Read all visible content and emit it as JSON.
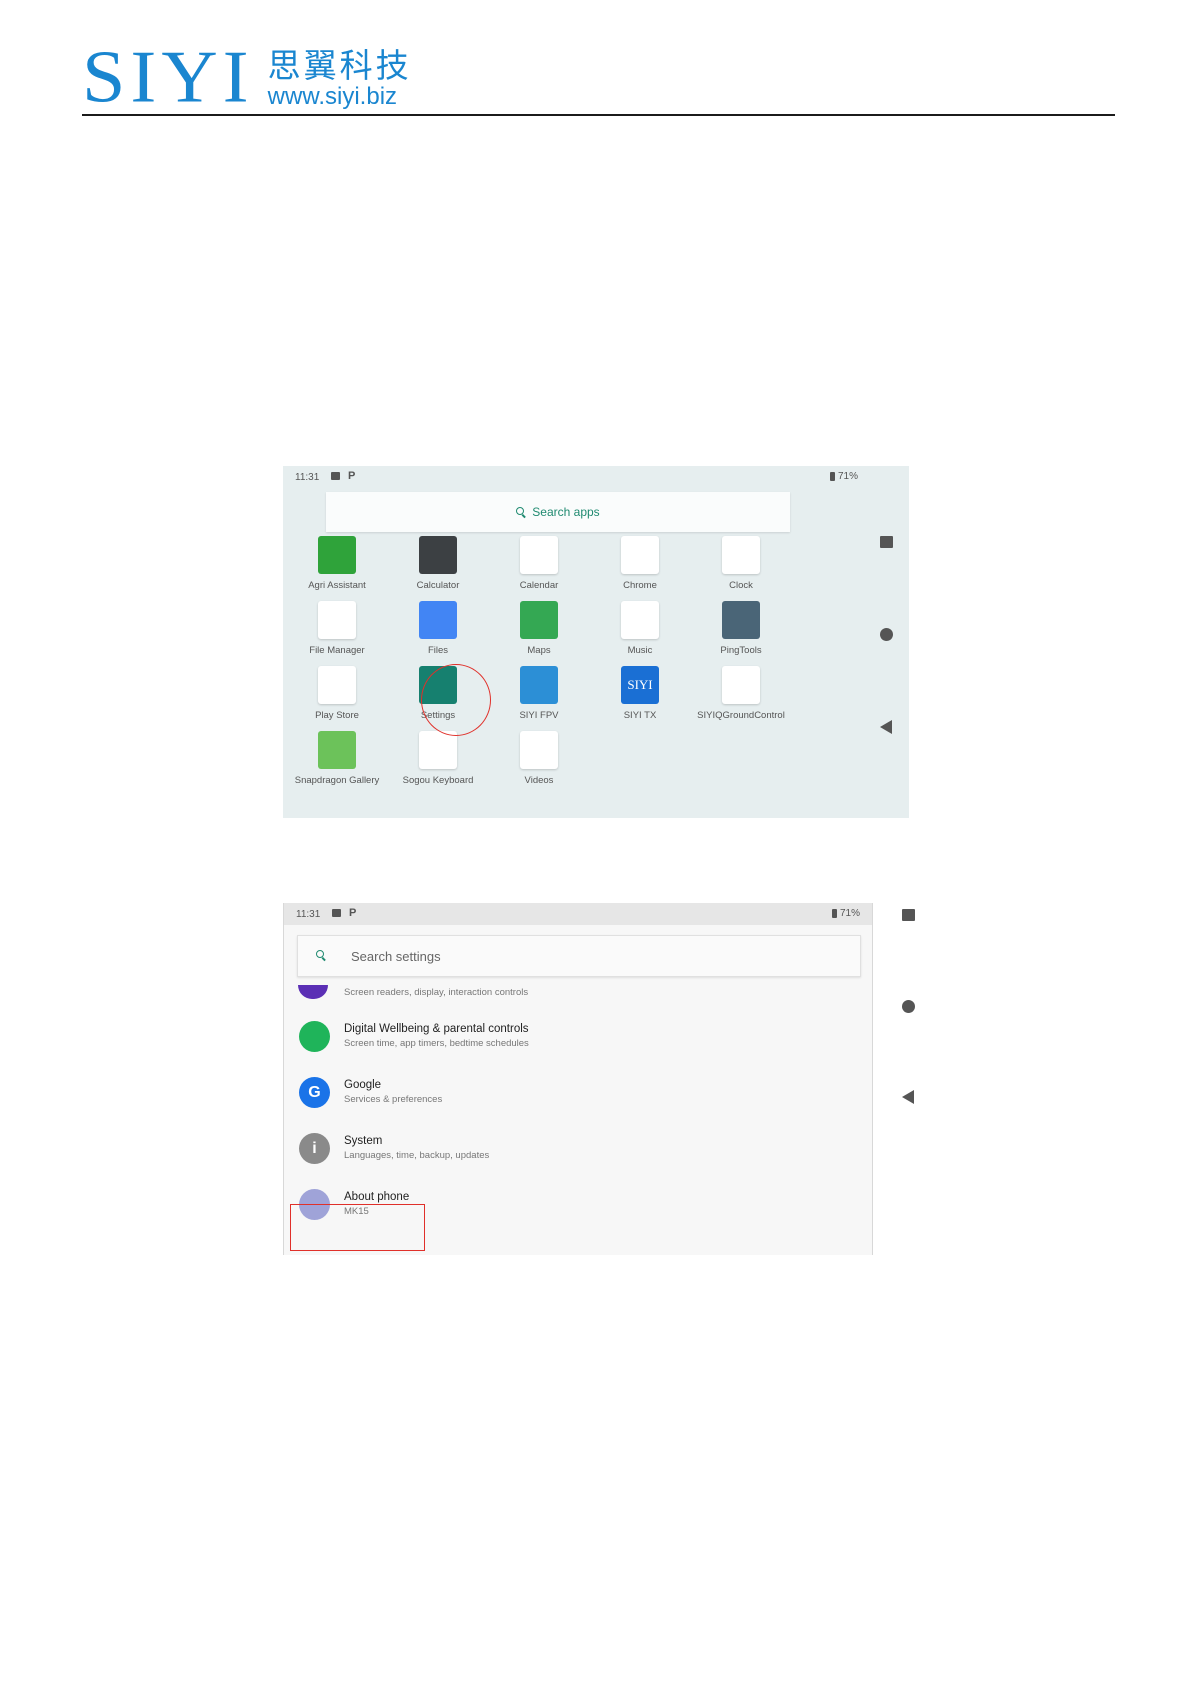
{
  "header": {
    "logo_latin": "SIYI",
    "logo_chinese": "思翼科技",
    "logo_url": "www.siyi.biz"
  },
  "launcher": {
    "status": {
      "time": "11:31",
      "notif": "P",
      "battery": "71%"
    },
    "search_label": "Search apps",
    "apps": [
      {
        "label": "Agri Assistant",
        "icon": "agri-assistant-icon",
        "color": "#2fa33a"
      },
      {
        "label": "Calculator",
        "icon": "calculator-icon",
        "color": "#3c4043"
      },
      {
        "label": "Calendar",
        "icon": "calendar-icon",
        "color": "#ffffff"
      },
      {
        "label": "Chrome",
        "icon": "chrome-icon",
        "color": "#ffffff"
      },
      {
        "label": "Clock",
        "icon": "clock-icon",
        "color": "#ffffff"
      },
      {
        "label": "File Manager",
        "icon": "file-manager-icon",
        "color": "#ffffff"
      },
      {
        "label": "Files",
        "icon": "files-icon",
        "color": "#4285f4"
      },
      {
        "label": "Maps",
        "icon": "maps-icon",
        "color": "#34a853"
      },
      {
        "label": "Music",
        "icon": "music-icon",
        "color": "#ffffff"
      },
      {
        "label": "PingTools",
        "icon": "pingtools-icon",
        "color": "#4a6577"
      },
      {
        "label": "Play Store",
        "icon": "play-store-icon",
        "color": "#ffffff"
      },
      {
        "label": "Settings",
        "icon": "settings-gear-icon",
        "color": "#16806f"
      },
      {
        "label": "SIYI FPV",
        "icon": "siyi-fpv-icon",
        "color": "#2c8fd6"
      },
      {
        "label": "SIYI TX",
        "icon": "siyi-tx-icon",
        "color": "#1a6fd4",
        "glyph": "SIYI"
      },
      {
        "label": "SIYIQGroundControl",
        "icon": "qgroundcontrol-icon",
        "color": "#ffffff"
      },
      {
        "label": "Snapdragon Gallery",
        "icon": "gallery-icon",
        "color": "#6cc25a"
      },
      {
        "label": "Sogou Keyboard",
        "icon": "sogou-keyboard-icon",
        "color": "#ffffff"
      },
      {
        "label": "Videos",
        "icon": "videos-icon",
        "color": "#ffffff"
      }
    ]
  },
  "settings": {
    "status": {
      "time": "11:31",
      "notif": "P",
      "battery": "71%"
    },
    "search_placeholder": "Search settings",
    "partial_row_subtitle": "Screen readers, display, interaction controls",
    "rows": [
      {
        "title": "Digital Wellbeing & parental controls",
        "subtitle": "Screen time, app timers, bedtime schedules",
        "icon": "digital-wellbeing-icon",
        "color": "#1fb45a"
      },
      {
        "title": "Google",
        "subtitle": "Services & preferences",
        "icon": "google-icon",
        "color": "#1a73e8",
        "glyph": "G"
      },
      {
        "title": "System",
        "subtitle": "Languages, time, backup, updates",
        "icon": "system-info-icon",
        "color": "#8a8a8a",
        "glyph": "i"
      },
      {
        "title": "About phone",
        "subtitle": "MK15",
        "icon": "about-phone-icon",
        "color": "#9fa3d8"
      }
    ]
  }
}
